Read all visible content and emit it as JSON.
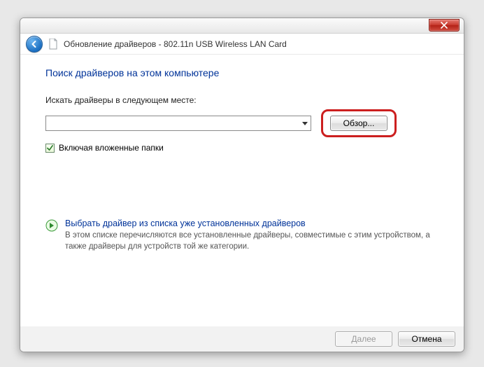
{
  "window": {
    "title": "Обновление драйверов - 802.11n USB Wireless LAN Card"
  },
  "main": {
    "heading": "Поиск драйверов на этом компьютере",
    "path_label": "Искать драйверы в следующем месте:",
    "path_value": "",
    "browse_label": "Обзор...",
    "include_subfolders_label": "Включая вложенные папки",
    "include_subfolders_checked": true
  },
  "list_option": {
    "title": "Выбрать драйвер из списка уже установленных драйверов",
    "description": "В этом списке перечисляются все установленные драйверы, совместимые с этим устройством, а также драйверы для устройств той же категории."
  },
  "footer": {
    "next_label": "Далее",
    "cancel_label": "Отмена"
  }
}
